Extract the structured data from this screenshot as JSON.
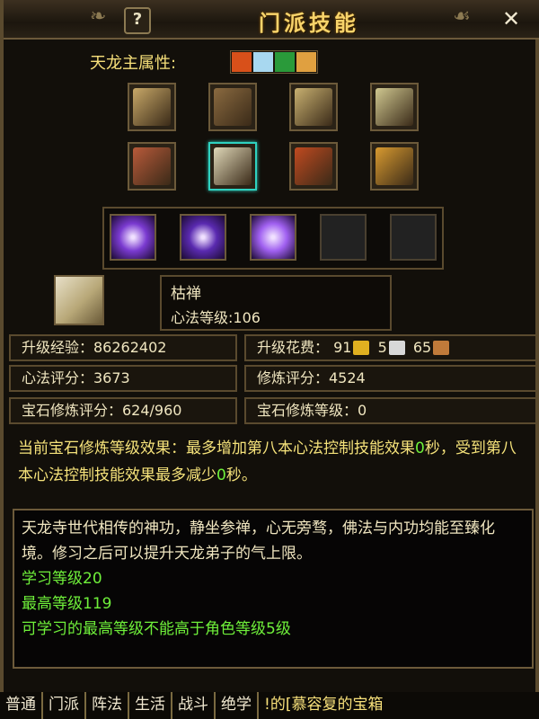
{
  "window": {
    "title": "门派技能",
    "help": "?",
    "close": "✕"
  },
  "attribute": {
    "label": "天龙主属性:",
    "icons": [
      "fire-icon",
      "ice-icon",
      "poison-icon",
      "lightning-icon"
    ],
    "colors": [
      "#d8501a",
      "#a8d8f0",
      "#2a9a3a",
      "#e0a040"
    ]
  },
  "books": [
    {
      "name": "book-scroll-1",
      "color": "#c8a868"
    },
    {
      "name": "book-scroll-2",
      "color": "#8a6a40"
    },
    {
      "name": "book-scroll-3",
      "color": "#c8b070"
    },
    {
      "name": "book-scroll-4",
      "color": "#d0c890"
    },
    {
      "name": "book-scroll-5",
      "color": "#b85a3a"
    },
    {
      "name": "book-scroll-6",
      "color": "#e0d8b8",
      "selected": true
    },
    {
      "name": "book-scroll-7",
      "color": "#c04a20"
    },
    {
      "name": "book-scroll-8",
      "color": "#d89a30"
    }
  ],
  "skills": [
    {
      "name": "skill-1",
      "color": "#7a3ad0"
    },
    {
      "name": "skill-2",
      "color": "#5a2ab0"
    },
    {
      "name": "skill-3",
      "color": "#a060f0"
    },
    {
      "name": "skill-4",
      "empty": true
    },
    {
      "name": "skill-5",
      "empty": true
    }
  ],
  "current": {
    "name": "枯禅",
    "level": "心法等级:106"
  },
  "stats": {
    "upgrade_exp": "升级经验：86262402",
    "upgrade_cost_label": "升级花费：",
    "cost_gold": "91",
    "cost_silver": "5",
    "cost_copper": "65",
    "xinfa_score": "心法评分：3673",
    "xiulian_score": "修炼评分：4524",
    "gem_score": "宝石修炼评分：624/960",
    "gem_level": "宝石修炼等级：0"
  },
  "effect": {
    "part1": "当前宝石修炼等级效果：最多增加第八本心法控制技能效果",
    "v1": "0",
    "part2": "秒，受到第八本心法控制技能效果最多减少",
    "v2": "0",
    "part3": "秒。"
  },
  "description": {
    "text": "天龙寺世代相传的神功，静坐参禅，心无旁骛，佛法与内功均能至臻化境。修习之后可以提升天龙弟子的气上限。",
    "learn_level": "学习等级20",
    "max_level": "最高等级119",
    "note": "可学习的最高等级不能高于角色等级5级"
  },
  "chat_tabs": [
    "普通",
    "门派",
    "阵法",
    "生活",
    "战斗",
    "绝学"
  ],
  "chat_news": "!的[慕容复的宝箱"
}
